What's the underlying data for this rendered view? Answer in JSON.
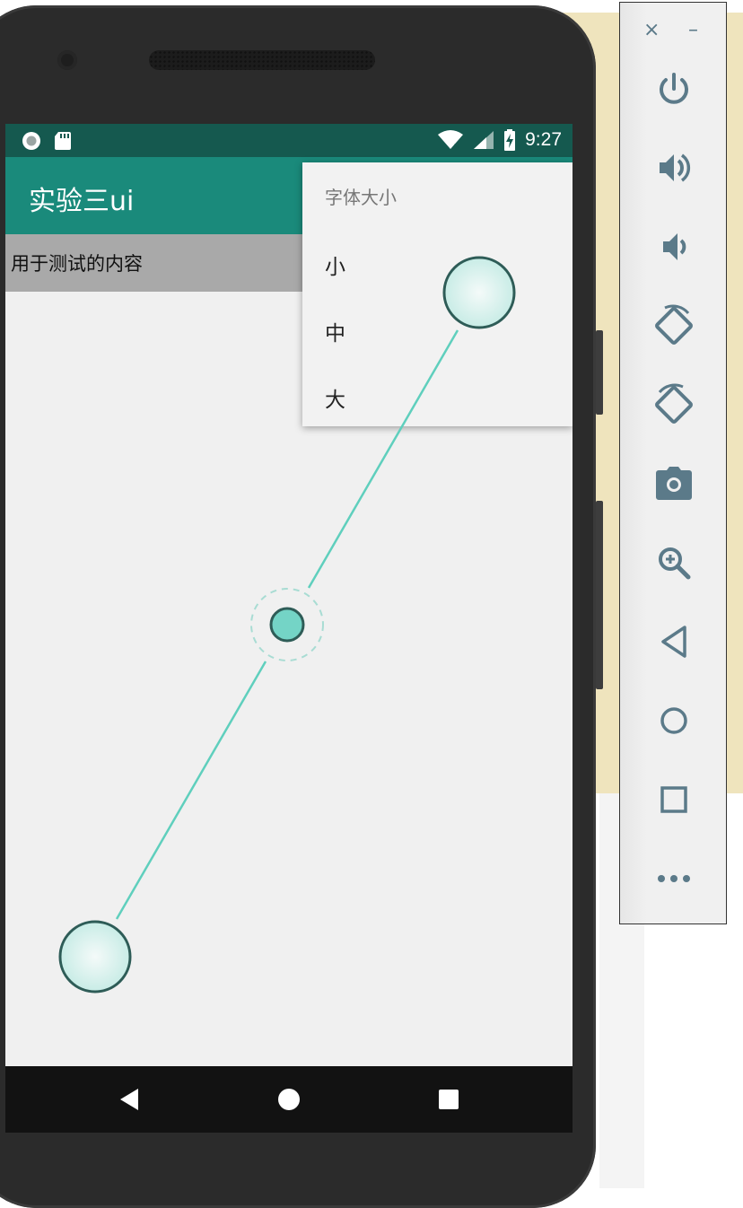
{
  "app": {
    "title": "实验三ui",
    "content_text": "用于测试的内容"
  },
  "status_bar": {
    "time": "9:27",
    "left_icons": [
      "circle-notification-icon",
      "sd-card-icon"
    ],
    "right_icons": [
      "wifi-icon",
      "signal-icon",
      "battery-charging-icon"
    ]
  },
  "menu": {
    "title": "字体大小",
    "items": [
      "小",
      "中",
      "大"
    ]
  },
  "nav_bar": {
    "buttons": [
      "back-icon",
      "home-icon",
      "recents-icon"
    ]
  },
  "toolbar": {
    "window_controls": [
      {
        "name": "close-icon",
        "label": "×"
      },
      {
        "name": "minimize-icon",
        "label": "–"
      }
    ],
    "buttons": [
      "power-icon",
      "volume-up-icon",
      "volume-down-icon",
      "rotate-left-icon",
      "rotate-right-icon",
      "camera-icon",
      "zoom-icon",
      "back-icon",
      "home-icon",
      "overview-icon",
      "more-icon"
    ]
  },
  "colors": {
    "status_bar": "#15594f",
    "app_bar": "#1a8a7b",
    "toolbar_icon": "#5b7a89",
    "gesture_line": "#5fcfbd"
  }
}
